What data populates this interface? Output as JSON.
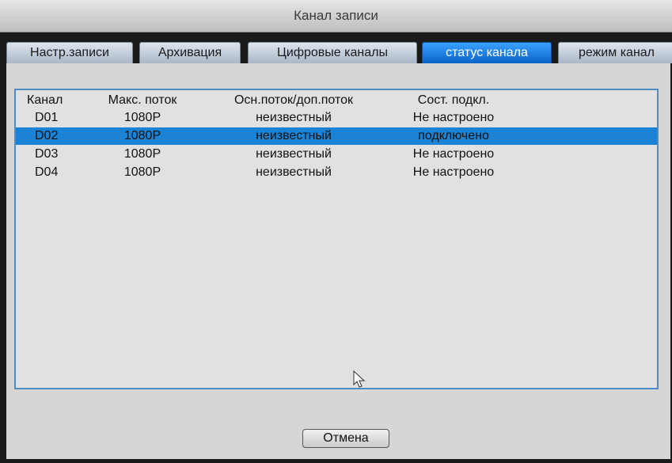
{
  "window": {
    "title": "Канал записи"
  },
  "tabs": [
    {
      "label": "Настр.записи"
    },
    {
      "label": "Архивация"
    },
    {
      "label": "Цифровые каналы"
    },
    {
      "label": "статус канала",
      "active": true
    },
    {
      "label": "режим канал"
    }
  ],
  "table": {
    "columns": [
      "Канал",
      "Макс. поток",
      "Осн.поток/доп.поток",
      "Сост. подкл."
    ],
    "rows": [
      {
        "channel": "D01",
        "max_stream": "1080P",
        "stream": "неизвестный",
        "status": "Не настроено"
      },
      {
        "channel": "D02",
        "max_stream": "1080P",
        "stream": "неизвестный",
        "status": "подключено",
        "selected": true
      },
      {
        "channel": "D03",
        "max_stream": "1080P",
        "stream": "неизвестный",
        "status": "Не настроено"
      },
      {
        "channel": "D04",
        "max_stream": "1080P",
        "stream": "неизвестный",
        "status": "Не настроено"
      }
    ]
  },
  "footer": {
    "cancel_label": "Отмена"
  },
  "colors": {
    "accent": "#1a83d6",
    "list_border": "#4d8cc6",
    "background": "#d6d6d6"
  },
  "icons": {
    "cursor": "mouse-pointer-icon"
  }
}
